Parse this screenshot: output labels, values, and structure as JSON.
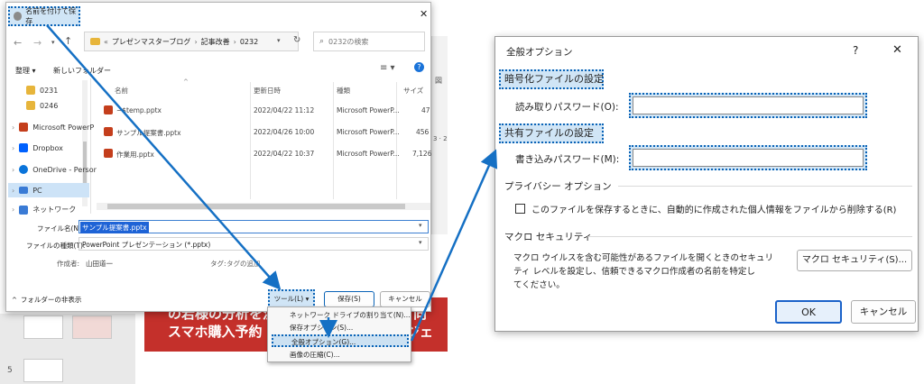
{
  "background": {
    "slide_text_line1": "の若様の分析を注",
    "slide_text_line2": "スマホ購入予約",
    "slide_text_tail1": "向",
    "slide_text_tail2": "エルジェ",
    "slide_number": "5",
    "side_label": "図",
    "side_numbers": "3 · 2"
  },
  "save_dialog": {
    "title": "名前を付けて保存",
    "breadcrumb": [
      "プレゼンマスターブログ",
      "記事改善",
      "0232"
    ],
    "search_placeholder": "0232の検索",
    "toolbar": {
      "organize": "整理 ▾",
      "new_folder": "新しいフォルダー"
    },
    "sidebar": [
      {
        "label": "0231",
        "color": "#e7b53b"
      },
      {
        "label": "0246",
        "color": "#e7b53b"
      },
      {
        "label": "Microsoft PowerP",
        "color": "#c43e1c"
      },
      {
        "label": "Dropbox",
        "color": "#0061fe"
      },
      {
        "label": "OneDrive - Persor",
        "color": "#0a74da"
      },
      {
        "label": "PC",
        "color": "#3a7bd5"
      },
      {
        "label": "ネットワーク",
        "color": "#3a7bd5"
      }
    ],
    "columns": [
      "名前",
      "更新日時",
      "種類",
      "サイズ"
    ],
    "files": [
      {
        "name": "~$temp.pptx",
        "date": "2022/04/22 11:12",
        "type": "Microsoft PowerP...",
        "size": "47"
      },
      {
        "name": "サンプル提案書.pptx",
        "date": "2022/04/26 10:00",
        "type": "Microsoft PowerP...",
        "size": "456"
      },
      {
        "name": "作業用.pptx",
        "date": "2022/04/22 10:37",
        "type": "Microsoft PowerP...",
        "size": "7,126"
      }
    ],
    "filename_label": "ファイル名(N):",
    "filename_value": "サンプル提案書.pptx",
    "filetype_label": "ファイルの種類(T):",
    "filetype_value": "PowerPoint プレゼンテーション (*.pptx)",
    "author_label": "作成者:",
    "author_value": "山田道一",
    "tag_label": "タグ:",
    "tag_value": "タグの追加",
    "hide_folders": "フォルダーの非表示",
    "tools_button": "ツール(L)",
    "save_button": "保存(S)",
    "cancel_button": "キャンセル"
  },
  "tools_menu": {
    "items": [
      "ネットワーク ドライブの割り当て(N)...",
      "保存オプション(S)...",
      "全般オプション(G)...",
      "画像の圧縮(C)..."
    ]
  },
  "general_options": {
    "title": "全般オプション",
    "help": "?",
    "close": "✕",
    "encrypt_heading": "暗号化ファイルの設定",
    "read_password_label": "読み取りパスワード(O):",
    "share_heading": "共有ファイルの設定",
    "write_password_label": "書き込みパスワード(M):",
    "privacy_heading": "プライバシー オプション",
    "privacy_checkbox": "このファイルを保存するときに、自動的に作成された個人情報をファイルから削除する(R)",
    "macro_heading": "マクロ セキュリティ",
    "macro_text": [
      "マクロ ウイルスを含む可能性があるファイルを開くときのセキュリ",
      "ティ レベルを設定し、信頼できるマクロ作成者の名前を特定し",
      "てください。"
    ],
    "macro_button": "マクロ セキュリティ(S)...",
    "ok": "OK",
    "cancel": "キャンセル"
  },
  "colors": {
    "highlight_border": "#0a63b6",
    "highlight_fill": "#aad0ee",
    "arrow": "#1570c4",
    "accent_red": "#c4302b"
  }
}
